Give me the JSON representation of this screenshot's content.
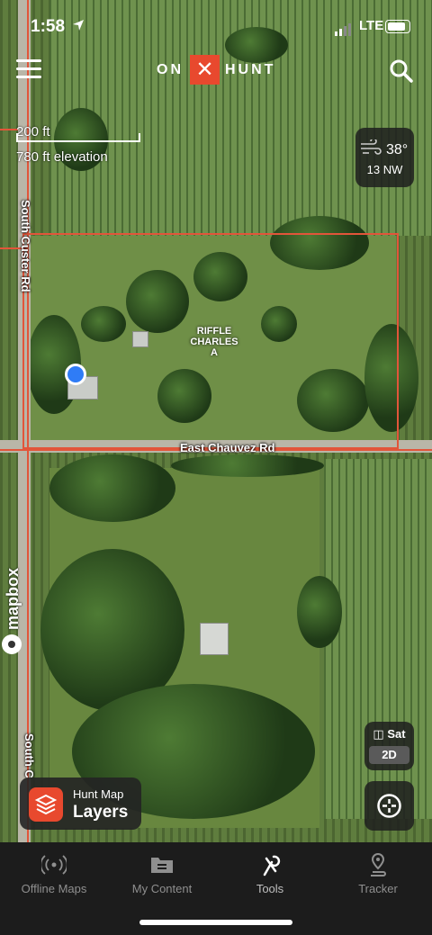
{
  "status_bar": {
    "time": "1:58",
    "network": "LTE"
  },
  "header": {
    "brand_left": "ON",
    "brand_mark": "✕",
    "brand_right": "HUNT"
  },
  "map": {
    "scale_label": "200 ft",
    "elevation_label": "780 ft elevation",
    "road_labels": {
      "south_custer_top": "South Custer Rd",
      "south_custer_bottom": "South C",
      "east_chauvez": "East Chauvez Rd"
    },
    "parcel_label": [
      "RIFFLE",
      "CHARLES",
      "A"
    ],
    "attribution": "mapbox"
  },
  "weather": {
    "temperature": "38°",
    "wind": "13 NW"
  },
  "map_controls": {
    "basemap": "Sat",
    "view_mode": "2D"
  },
  "layers_button": {
    "subtitle": "Hunt Map",
    "title": "Layers"
  },
  "tabbar": {
    "tabs": [
      {
        "label": "Offline Maps"
      },
      {
        "label": "My Content"
      },
      {
        "label": "Tools"
      },
      {
        "label": "Tracker"
      }
    ]
  },
  "colors": {
    "brand_red": "#e8492e",
    "boundary_red": "#e2553a",
    "location_blue": "#2f7cf6"
  }
}
